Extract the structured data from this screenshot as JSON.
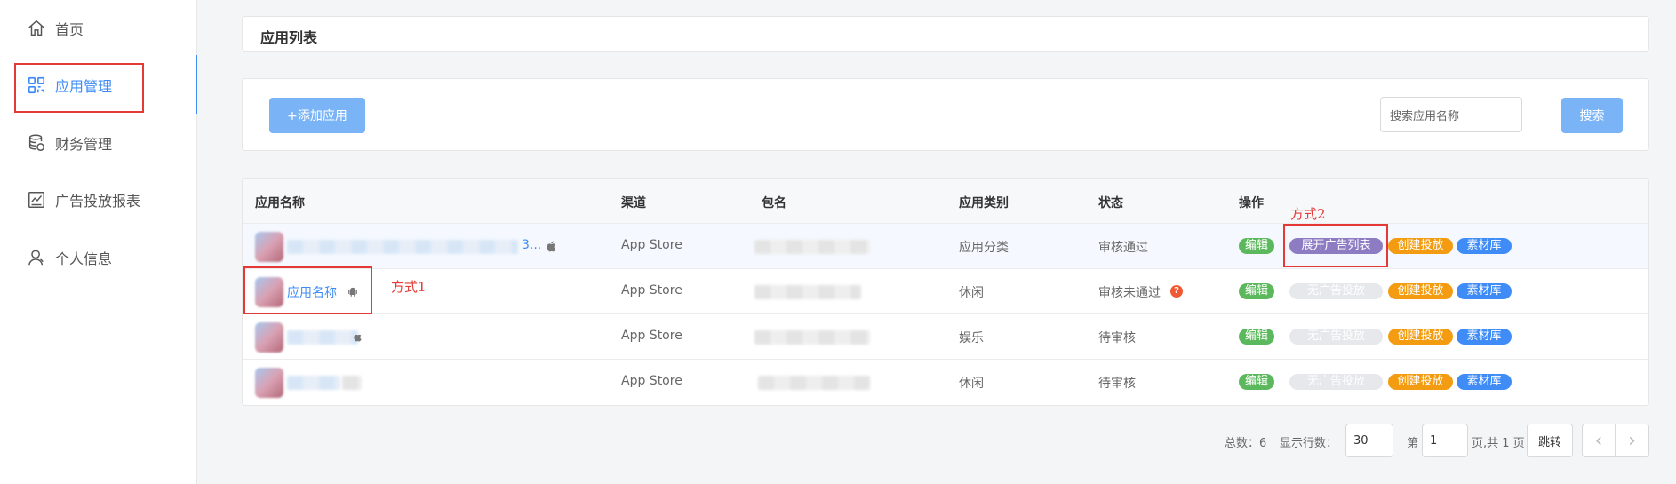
{
  "sidebar": {
    "items": [
      {
        "label": "首页",
        "icon": "home-icon"
      },
      {
        "label": "应用管理",
        "icon": "grid-icon"
      },
      {
        "label": "财务管理",
        "icon": "database-icon"
      },
      {
        "label": "广告投放报表",
        "icon": "chart-icon"
      },
      {
        "label": "个人信息",
        "icon": "user-icon"
      }
    ],
    "active_color": "#3f8cf7"
  },
  "header": {
    "title": "应用列表"
  },
  "toolbar": {
    "add_label": "+添加应用",
    "search_placeholder": "搜索应用名称",
    "search_label": "搜索"
  },
  "table": {
    "columns": [
      "应用名称",
      "渠道",
      "包名",
      "应用类别",
      "状态",
      "操作"
    ],
    "rows": [
      {
        "name_suffix": "3...",
        "platform": "apple",
        "channel": "App Store",
        "category": "应用分类",
        "status": "审核通过",
        "actions": [
          "编辑",
          "展开广告列表",
          "创建投放",
          "素材库"
        ]
      },
      {
        "name": "应用名称",
        "platform": "android",
        "channel": "App Store",
        "category": "休闲",
        "status": "审核未通过",
        "help": "?",
        "actions": [
          "编辑",
          "无广告投放",
          "创建投放",
          "素材库"
        ]
      },
      {
        "platform": "apple",
        "channel": "App Store",
        "category": "娱乐",
        "status": "待审核",
        "actions": [
          "编辑",
          "无广告投放",
          "创建投放",
          "素材库"
        ]
      },
      {
        "platform": "",
        "channel": "App Store",
        "category": "休闲",
        "status": "待审核",
        "actions": [
          "编辑",
          "无广告投放",
          "创建投放",
          "素材库"
        ]
      }
    ]
  },
  "annotations": {
    "method1": "方式1",
    "method2": "方式2"
  },
  "pagination": {
    "total_label": "总数：6",
    "rows_label": "显示行数：",
    "rows_value": "30",
    "page_prefix": "第",
    "page_value": "1",
    "page_suffix": "页,共 1 页",
    "jump_label": "跳转"
  }
}
